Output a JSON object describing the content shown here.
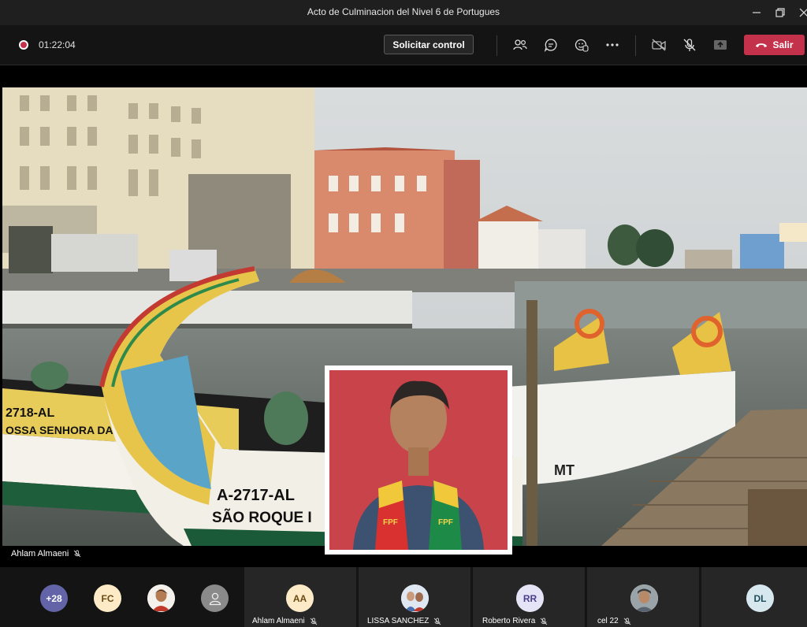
{
  "window": {
    "title": "Acto de Culminacion del Nivel 6 de Portugues"
  },
  "toolbar": {
    "timer": "01:22:04",
    "request_control_label": "Solicitar control",
    "leave_label": "Salir",
    "icons": [
      "people-icon",
      "chat-icon",
      "reactions-icon",
      "more-icon",
      "camera-off-icon",
      "mic-off-icon",
      "share-icon"
    ]
  },
  "stage": {
    "presenter_name": "Ahlam Almaeni",
    "scene_boats": [
      {
        "reg": "2718-AL",
        "name": "OSSA SENHORA DAS ARE"
      },
      {
        "reg": "A-2717-AL",
        "name": "SÃO ROQUE I"
      },
      {
        "reg": "MT"
      }
    ],
    "scarf_text": "FPF"
  },
  "participants": {
    "overflow_count": "+28",
    "small_avatars": [
      {
        "initials": "FC",
        "bg": "#fcebc6",
        "fg": "#6b4a12"
      },
      {
        "initials": "",
        "kind": "photo"
      },
      {
        "initials": "",
        "kind": "generic"
      }
    ],
    "tiles": [
      {
        "name": "Ahlam Almaeni",
        "initials": "AA",
        "bg": "#fcebc6",
        "fg": "#6b4a12"
      },
      {
        "name": "LISSA SANCHEZ",
        "initials": "",
        "kind": "photo"
      },
      {
        "name": "Roberto Rivera",
        "initials": "RR",
        "bg": "#e5e3f6",
        "fg": "#4b3d8f"
      },
      {
        "name": "cel 22",
        "initials": "",
        "kind": "photo"
      },
      {
        "name": "",
        "initials": "DL",
        "bg": "#d6e8ee",
        "fg": "#1f4c5a"
      }
    ]
  },
  "colors": {
    "accent": "#6264a7",
    "leave": "#c4314b"
  }
}
